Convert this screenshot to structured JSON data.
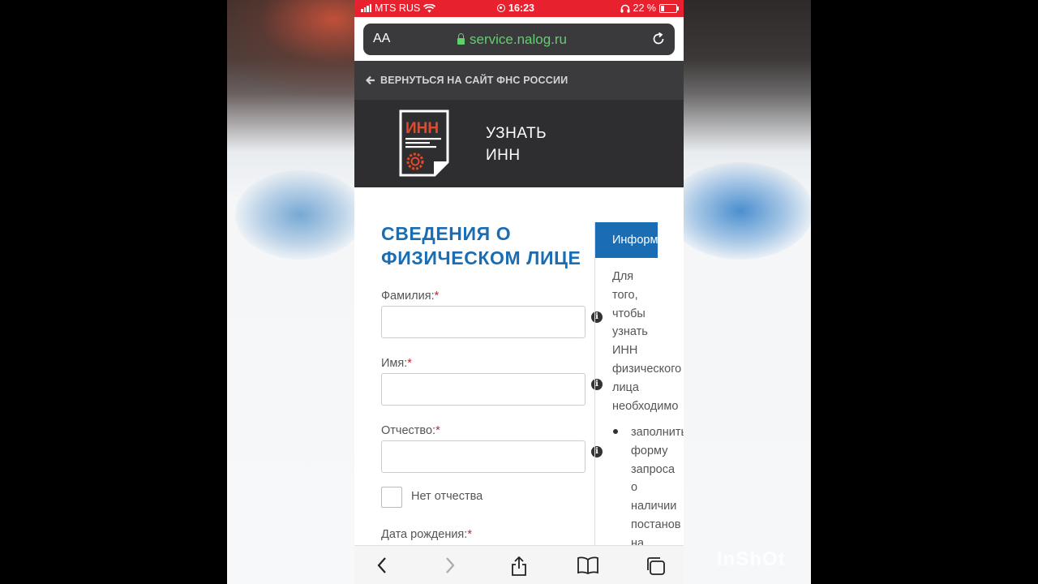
{
  "status_bar": {
    "carrier": "MTS RUS",
    "time": "16:23",
    "battery": "22 %"
  },
  "browser": {
    "text_size_label": "AA",
    "url": "service.nalog.ru"
  },
  "site": {
    "back_link": "ВЕРНУТЬСЯ НА САЙТ ФНС РОССИИ",
    "logo_text": "ИНН",
    "title_line1": "УЗНАТЬ",
    "title_line2": "ИНН"
  },
  "form": {
    "heading_line1": "СВЕДЕНИЯ О",
    "heading_line2": "ФИЗИЧЕСКОМ ЛИЦЕ",
    "required_mark": "*",
    "fields": [
      {
        "label": "Фамилия:",
        "value": ""
      },
      {
        "label": "Имя:",
        "value": ""
      },
      {
        "label": "Отчество:",
        "value": ""
      }
    ],
    "no_patronymic_label": "Нет отчества",
    "birth_date_label": "Дата рождения:"
  },
  "info_panel": {
    "tab_label": "Информ",
    "lines": [
      "Для",
      "того,",
      "чтобы",
      "узнать",
      "ИНН",
      "физического",
      "лица",
      "необходимо"
    ],
    "bullet_lines": [
      "заполнить",
      "форму",
      "запроса",
      "о",
      "наличии",
      "постанов",
      "на"
    ]
  },
  "watermark": "InShOt",
  "colors": {
    "status_red": "#e8212f",
    "accent_blue": "#1a6db3",
    "header_dark": "#2e2e30",
    "url_green": "#5fd06b",
    "required_red": "#c0272d"
  }
}
